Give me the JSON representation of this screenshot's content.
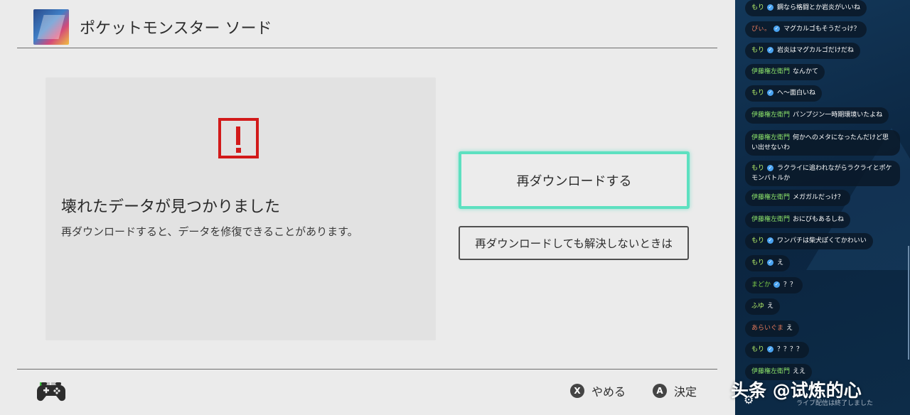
{
  "header": {
    "title": "ポケットモンスター ソード"
  },
  "error": {
    "title": "壊れたデータが見つかりました",
    "description": "再ダウンロードすると、データを修復できることがあります。"
  },
  "actions": {
    "redownload_label": "再ダウンロードする",
    "help_label": "再ダウンロードしても解決しないときは"
  },
  "footer": {
    "hints": [
      {
        "button": "X",
        "label": "やめる"
      },
      {
        "button": "A",
        "label": "決定"
      }
    ]
  },
  "chat": {
    "messages": [
      {
        "user": "もり",
        "verified": true,
        "text": "鋼なら格闘とか岩炎がいいね",
        "user_color": "#b6f06a"
      },
      {
        "user": "ぴぃ。",
        "verified": true,
        "text": "マグカルゴもそうだっけ？",
        "user_color": "#e67a5c"
      },
      {
        "user": "もり",
        "verified": true,
        "text": "岩炎はマグカルゴだけだね",
        "user_color": "#b6f06a"
      },
      {
        "user": "伊藤権左衛門",
        "verified": false,
        "text": "なんかて",
        "user_color": "#8de56b"
      },
      {
        "user": "もり",
        "verified": true,
        "text": "へ〜面白いね",
        "user_color": "#b6f06a"
      },
      {
        "user": "伊藤権左衛門",
        "verified": false,
        "text": "パンプジン一時期環境いたよね",
        "user_color": "#8de56b"
      },
      {
        "user": "伊藤権左衛門",
        "verified": false,
        "text": "何かへのメタになったんだけど思い出せないわ",
        "user_color": "#8de56b"
      },
      {
        "user": "もり",
        "verified": true,
        "text": "ラクライに追われながらラクライとポケモンバトルか",
        "user_color": "#b6f06a"
      },
      {
        "user": "伊藤権左衛門",
        "verified": false,
        "text": "メガガルだっけ？",
        "user_color": "#8de56b"
      },
      {
        "user": "伊藤権左衛門",
        "verified": false,
        "text": "おにびもあるしね",
        "user_color": "#8de56b"
      },
      {
        "user": "もり",
        "verified": true,
        "text": "ワンパチは柴犬ぽくてかわいい",
        "user_color": "#b6f06a"
      },
      {
        "user": "もり",
        "verified": true,
        "text": "え",
        "user_color": "#b6f06a"
      },
      {
        "user": "まどか",
        "verified": true,
        "text": "？？",
        "user_color": "#7fd04a"
      },
      {
        "user": "ふゆ",
        "verified": false,
        "text": "え",
        "user_color": "#b6f06a"
      },
      {
        "user": "あらいぐま",
        "verified": false,
        "text": "え",
        "user_color": "#e67a5c"
      },
      {
        "user": "もり",
        "verified": true,
        "text": "？？？？",
        "user_color": "#b6f06a"
      },
      {
        "user": "伊藤権左衛門",
        "verified": false,
        "text": "ええ",
        "user_color": "#8de56b"
      }
    ],
    "footer_note": "ライブ配信は終了しました"
  },
  "watermark": "头条 @试炼的心",
  "colors": {
    "accent_focus": "#5de0c0",
    "error_red": "#d21a1a",
    "chat_bg": "#0e2a44"
  }
}
